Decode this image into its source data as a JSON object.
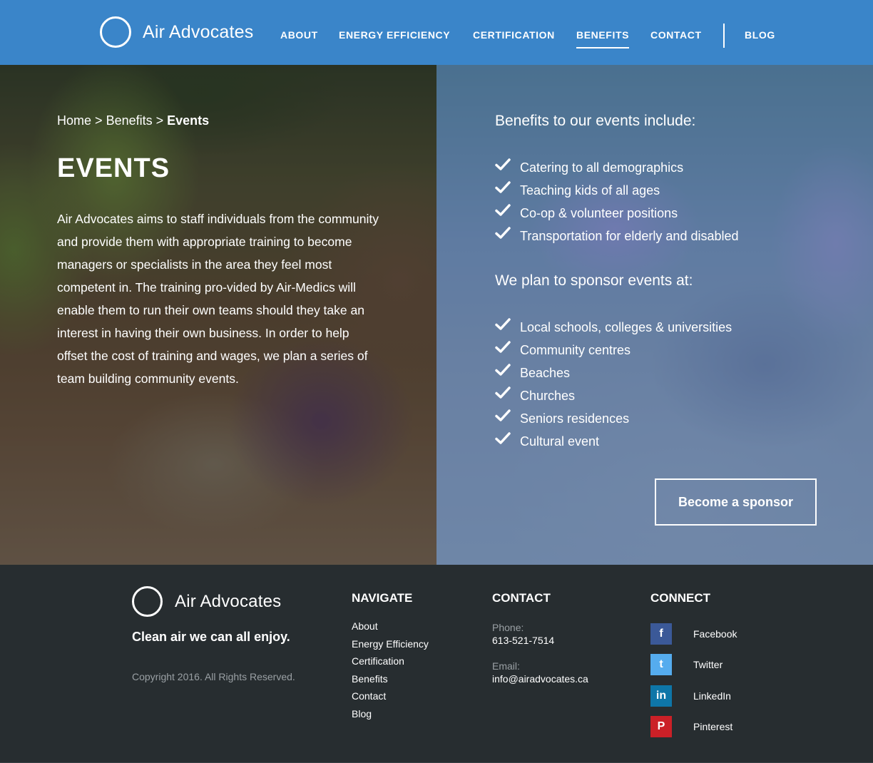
{
  "header": {
    "brand": "Air Advocates",
    "nav": [
      {
        "label": "ABOUT"
      },
      {
        "label": "ENERGY EFFICIENCY"
      },
      {
        "label": "CERTIFICATION"
      },
      {
        "label": "BENEFITS",
        "active": true
      },
      {
        "label": "CONTACT"
      },
      {
        "label": "BLOG"
      }
    ]
  },
  "hero": {
    "breadcrumb": {
      "home": "Home",
      "sep": ">",
      "parent": "Benefits",
      "current": "Events"
    },
    "title": "EVENTS",
    "intro": "Air Advocates aims to staff individuals from the community and provide them with appropriate training to become managers or specialists in the area they feel most competent in. The training pro-vided by Air-Medics will enable them to run their own teams should they take an interest in having their own business. In order to help offset the cost of training and wages, we plan a series of team building community events.",
    "benefits_heading": "Benefits to our events include:",
    "benefits": [
      "Catering to all demographics",
      "Teaching kids of all ages",
      "Co-op & volunteer positions",
      "Transportation for elderly and disabled"
    ],
    "sponsor_heading": "We plan to sponsor events at:",
    "sponsor_places": [
      "Local schools, colleges & universities",
      "Community centres",
      "Beaches",
      "Churches",
      "Seniors residences",
      "Cultural event"
    ],
    "cta_label": "Become a sponsor"
  },
  "footer": {
    "brand": "Air Advocates",
    "tagline": "Clean air we can all enjoy.",
    "copyright": "Copyright 2016. All Rights Reserved.",
    "navigate_heading": "NAVIGATE",
    "navigate_links": [
      "About",
      "Energy Efficiency",
      "Certification",
      "Benefits",
      "Contact",
      "Blog"
    ],
    "contact_heading": "CONTACT",
    "phone_label": "Phone:",
    "phone": "613-521-7514",
    "email_label": "Email:",
    "email": "info@airadvocates.ca",
    "connect_heading": "CONNECT",
    "social": [
      {
        "name": "Facebook",
        "icon": "facebook-icon",
        "color": "#3b5998",
        "glyph": "f"
      },
      {
        "name": "Twitter",
        "icon": "twitter-icon",
        "color": "#55acee",
        "glyph": "t"
      },
      {
        "name": "LinkedIn",
        "icon": "linkedin-icon",
        "color": "#0e76a8",
        "glyph": "in"
      },
      {
        "name": "Pinterest",
        "icon": "pinterest-icon",
        "color": "#cb2027",
        "glyph": "P"
      }
    ]
  }
}
